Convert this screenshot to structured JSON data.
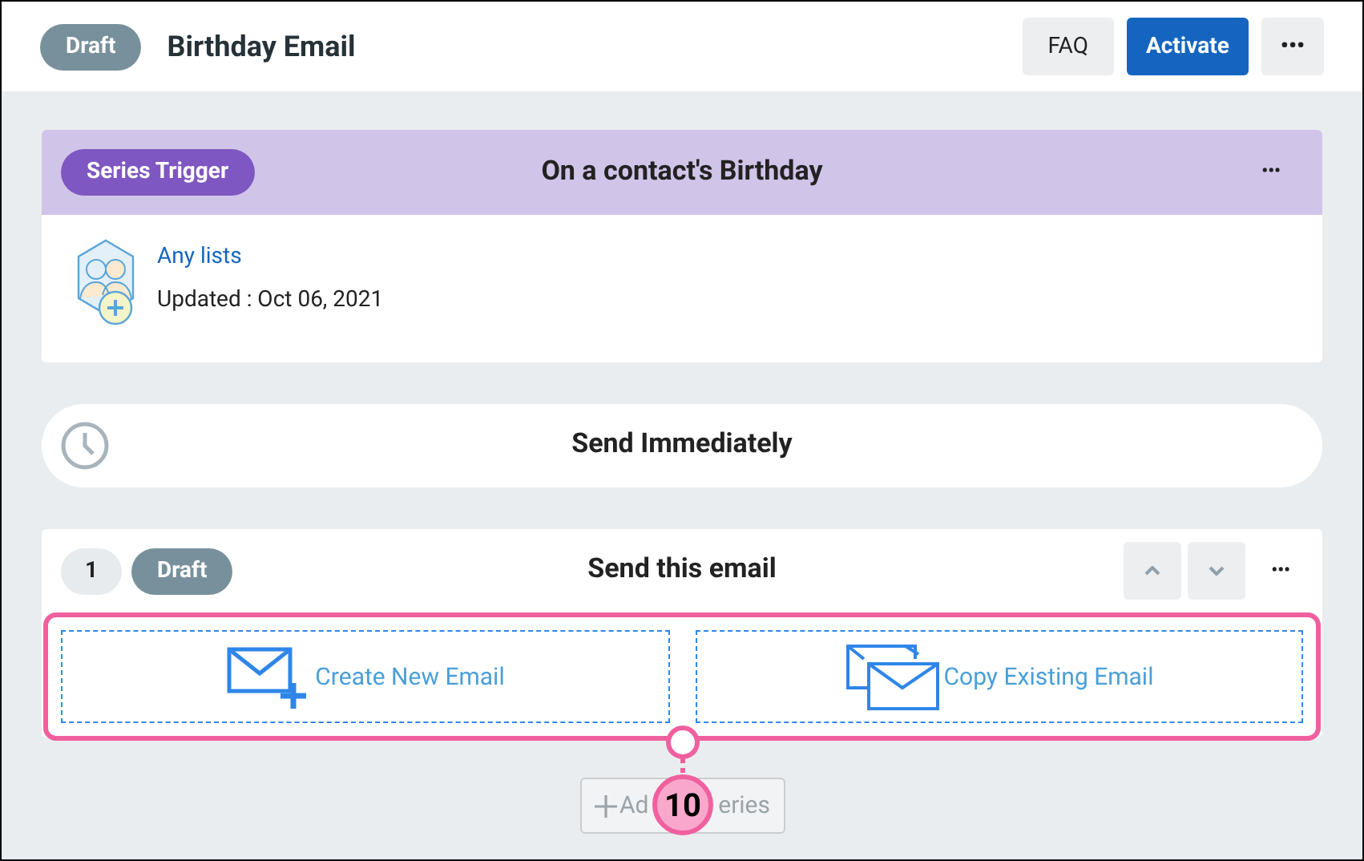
{
  "header": {
    "status": "Draft",
    "title": "Birthday Email",
    "buttons": [
      {
        "kind": "secondary",
        "label": "FAQ"
      },
      {
        "kind": "primary",
        "label": "Activate"
      },
      {
        "kind": "more",
        "label": "•••"
      }
    ]
  },
  "trigger": {
    "badge": "Series Trigger",
    "title": "On a contact's Birthday",
    "menu": "•••",
    "link": "Any lists",
    "updated": "Updated : Oct 06, 2021"
  },
  "delay": {
    "title": "Send Immediately"
  },
  "step": {
    "number": "1",
    "status": "Draft",
    "title": "Send this email",
    "menu": "•••",
    "options": [
      {
        "kind": "create",
        "label": "Create New Email"
      },
      {
        "kind": "copy",
        "label": "Copy Existing Email"
      }
    ]
  },
  "add_button": {
    "label_start": "Ad",
    "label_end": "eries"
  },
  "callout": {
    "number": "10"
  }
}
